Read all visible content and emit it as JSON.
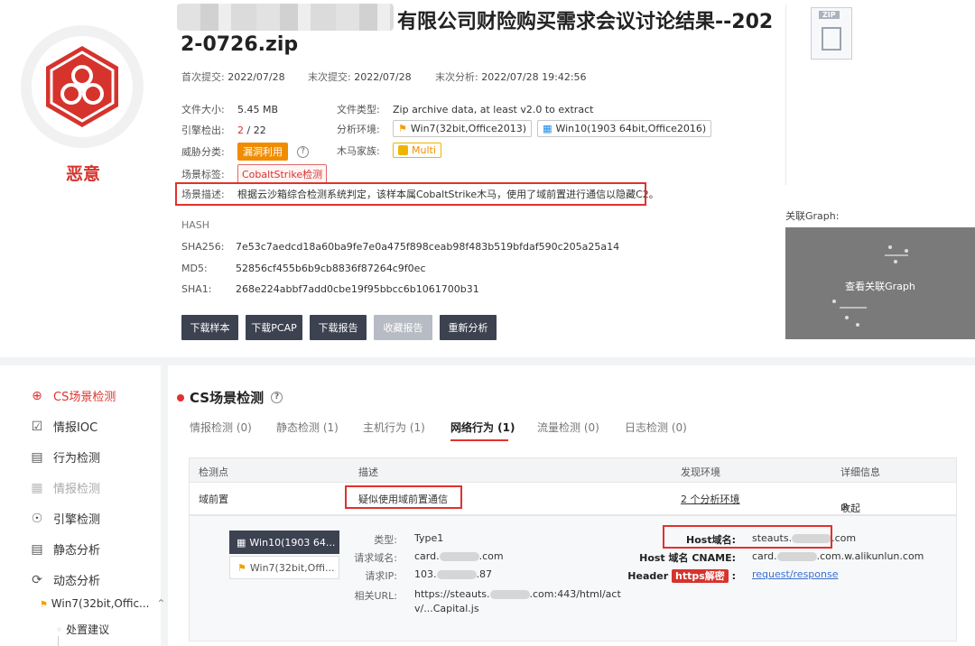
{
  "verdict": "恶意",
  "file": {
    "title_line1": "有限公司财险购买需求会议讨论结果--202",
    "title_line2": "2-0726.zip",
    "zip_label": "ZIP"
  },
  "submission": {
    "first_submit_label": "首次提交:",
    "first_submit": "2022/07/28",
    "last_submit_label": "末次提交:",
    "last_submit": "2022/07/28",
    "last_analysis_label": "末次分析:",
    "last_analysis": "2022/07/28 19:42:56"
  },
  "info": {
    "size_label": "文件大小:",
    "size": "5.45 MB",
    "type_label": "文件类型:",
    "type": "Zip archive data, at least v2.0 to extract",
    "engine_label": "引擎检出:",
    "engine_hits": "2",
    "engine_total": "/ 22",
    "env_label": "分析环境:",
    "env1": "Win7(32bit,Office2013)",
    "env2": "Win10(1903 64bit,Office2016)",
    "threat_label": "威胁分类:",
    "threat": "漏洞利用",
    "family_label": "木马家族:",
    "family": "Multi",
    "scene_label": "场景标签:",
    "scene_tag": "CobaltStrike检测",
    "desc_label": "场景描述:",
    "desc": "根据云沙箱综合检测系统判定，该样本属CobaltStrike木马，使用了域前置进行通信以隐藏C2。"
  },
  "hash": {
    "heading": "HASH",
    "sha256_label": "SHA256:",
    "sha256": "7e53c7aedcd18a60ba9fe7e0a475f898ceab98f483b519bfdaf590c205a25a14",
    "md5_label": "MD5:",
    "md5": "52856cf455b6b9cb8836f87264c9f0ec",
    "sha1_label": "SHA1:",
    "sha1": "268e224abbf7add0cbe19f95bbcc6b1061700b31"
  },
  "buttons": {
    "download_sample": "下载样本",
    "download_pcap": "下载PCAP",
    "download_report": "下载报告",
    "favorite_report": "收藏报告",
    "reanalyze": "重新分析"
  },
  "graph": {
    "label": "关联Graph:",
    "view": "查看关联Graph"
  },
  "sidebar": {
    "items": [
      {
        "label": "CS场景检测"
      },
      {
        "label": "情报IOC"
      },
      {
        "label": "行为检测"
      },
      {
        "label": "情报检测"
      },
      {
        "label": "引擎检测"
      },
      {
        "label": "静态分析"
      },
      {
        "label": "动态分析"
      }
    ],
    "sub_env": "Win7(32bit,Offic...",
    "sub_item": "处置建议"
  },
  "section": {
    "title": "CS场景检测",
    "tabs": [
      {
        "label": "情报检测 (0)"
      },
      {
        "label": "静态检测 (1)"
      },
      {
        "label": "主机行为 (1)"
      },
      {
        "label": "网络行为 (1)"
      },
      {
        "label": "流量检测 (0)"
      },
      {
        "label": "日志检测 (0)"
      }
    ]
  },
  "table": {
    "headers": [
      "检测点",
      "描述",
      "发现环境",
      "详细信息"
    ],
    "row": {
      "point": "域前置",
      "desc": "疑似使用域前置通信",
      "env": "2 个分析环境",
      "detail": "收起"
    }
  },
  "detail": {
    "env_win10": "Win10(1903 64...",
    "env_win7": "Win7(32bit,Offi...",
    "type_label": "类型:",
    "type": "Type1",
    "req_domain_label": "请求域名:",
    "req_domain_pre": "card.",
    "req_domain_post": ".com",
    "req_ip_label": "请求IP:",
    "req_ip_pre": "103.",
    "req_ip_post": ".87",
    "url_label": "相关URL:",
    "url_pre": "https://steauts.",
    "url_post": ".com:443/html/act",
    "url_line2": "v/...Capital.js",
    "host_label": "Host域名:",
    "host_pre": "steauts.",
    "host_post": ".com",
    "cname_label": "Host 域名 CNAME:",
    "cname_pre": "card.",
    "cname_post": ".com.w.alikunlun.com",
    "header_label": "Header",
    "https_tag": "https解密",
    "header_link": "request/response"
  },
  "colors": {
    "accent_red": "#e0322d",
    "dark_button": "#3c4250",
    "orange": "#f08c00"
  }
}
